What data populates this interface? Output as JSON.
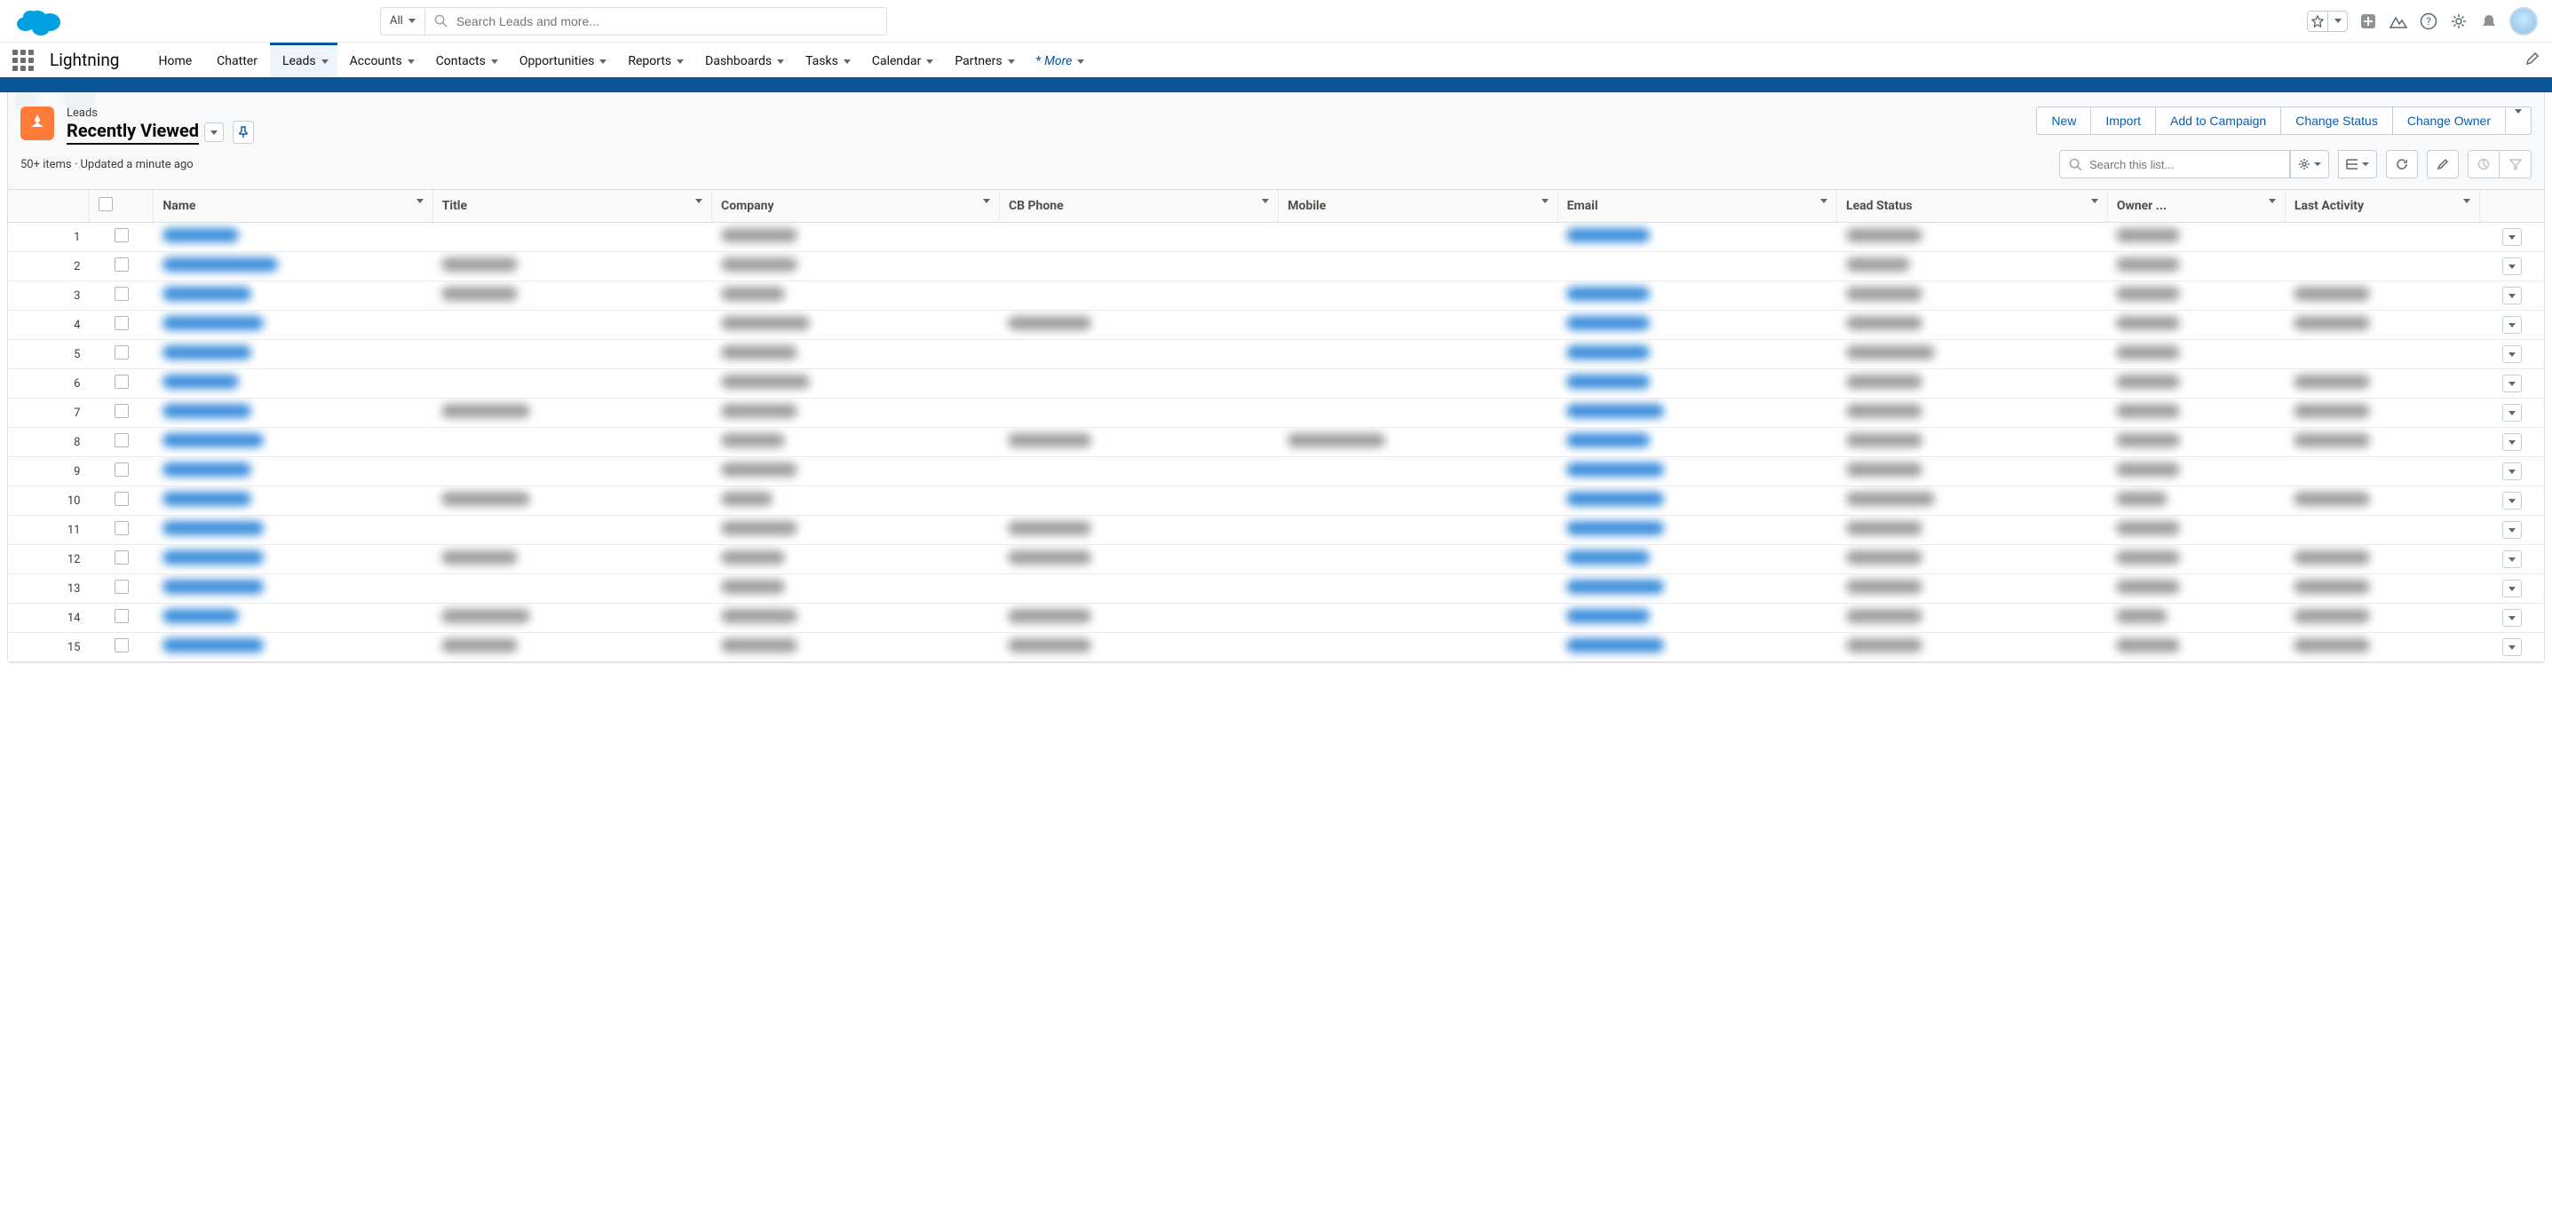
{
  "search": {
    "scope": "All",
    "placeholder": "Search Leads and more..."
  },
  "app_name": "Lightning",
  "nav": {
    "items": [
      "Home",
      "Chatter",
      "Leads",
      "Accounts",
      "Contacts",
      "Opportunities",
      "Reports",
      "Dashboards",
      "Tasks",
      "Calendar",
      "Partners"
    ],
    "more": "More",
    "active": "Leads"
  },
  "page": {
    "object_label": "Leads",
    "view_name": "Recently Viewed",
    "meta": "50+ items · Updated a minute ago"
  },
  "actions": {
    "new": "New",
    "import": "Import",
    "add_to_campaign": "Add to Campaign",
    "change_status": "Change Status",
    "change_owner": "Change Owner"
  },
  "list_toolbar": {
    "search_placeholder": "Search this list..."
  },
  "columns": {
    "name": "Name",
    "title": "Title",
    "company": "Company",
    "cb_phone": "CB Phone",
    "mobile": "Mobile",
    "email": "Email",
    "lead_status": "Lead Status",
    "owner": "Owner ...",
    "last_activity": "Last Activity"
  },
  "rows": [
    {
      "n": 1,
      "name": "████",
      "title": "",
      "company": "████",
      "cb_phone": "",
      "mobile": "",
      "email": "████",
      "status": "████",
      "owner": "███",
      "activity": ""
    },
    {
      "n": 2,
      "name": "████████",
      "title": "████",
      "company": "████",
      "cb_phone": "",
      "mobile": "",
      "email": "",
      "status": "███",
      "owner": "███",
      "activity": ""
    },
    {
      "n": 3,
      "name": "█████",
      "title": "████",
      "company": "███",
      "cb_phone": "",
      "mobile": "",
      "email": "████",
      "status": "████",
      "owner": "███",
      "activity": "████"
    },
    {
      "n": 4,
      "name": "██████",
      "title": "",
      "company": "█████",
      "cb_phone": "████",
      "mobile": "",
      "email": "████",
      "status": "████",
      "owner": "███",
      "activity": "████"
    },
    {
      "n": 5,
      "name": "█████",
      "title": "",
      "company": "████",
      "cb_phone": "",
      "mobile": "",
      "email": "████",
      "status": "█████",
      "owner": "███",
      "activity": ""
    },
    {
      "n": 6,
      "name": "████",
      "title": "",
      "company": "█████",
      "cb_phone": "",
      "mobile": "",
      "email": "████",
      "status": "████",
      "owner": "███",
      "activity": "████"
    },
    {
      "n": 7,
      "name": "█████",
      "title": "█████",
      "company": "████",
      "cb_phone": "",
      "mobile": "",
      "email": "█████",
      "status": "████",
      "owner": "███",
      "activity": "████"
    },
    {
      "n": 8,
      "name": "██████",
      "title": "",
      "company": "███",
      "cb_phone": "████",
      "mobile": "█████",
      "email": "████",
      "status": "████",
      "owner": "███",
      "activity": "████"
    },
    {
      "n": 9,
      "name": "█████",
      "title": "",
      "company": "████",
      "cb_phone": "",
      "mobile": "",
      "email": "█████",
      "status": "████",
      "owner": "███",
      "activity": ""
    },
    {
      "n": 10,
      "name": "█████",
      "title": "█████",
      "company": "██",
      "cb_phone": "",
      "mobile": "",
      "email": "█████",
      "status": "█████",
      "owner": "██",
      "activity": "████"
    },
    {
      "n": 11,
      "name": "██████",
      "title": "",
      "company": "████",
      "cb_phone": "████",
      "mobile": "",
      "email": "█████",
      "status": "████",
      "owner": "███",
      "activity": ""
    },
    {
      "n": 12,
      "name": "██████",
      "title": "████",
      "company": "███",
      "cb_phone": "████",
      "mobile": "",
      "email": "████",
      "status": "████",
      "owner": "███",
      "activity": "████"
    },
    {
      "n": 13,
      "name": "██████",
      "title": "",
      "company": "███",
      "cb_phone": "",
      "mobile": "",
      "email": "█████",
      "status": "████",
      "owner": "███",
      "activity": "████"
    },
    {
      "n": 14,
      "name": "████",
      "title": "█████",
      "company": "████",
      "cb_phone": "████",
      "mobile": "",
      "email": "████",
      "status": "████",
      "owner": "██",
      "activity": "████"
    },
    {
      "n": 15,
      "name": "██████",
      "title": "████",
      "company": "████",
      "cb_phone": "████",
      "mobile": "",
      "email": "█████",
      "status": "████",
      "owner": "███",
      "activity": "████"
    }
  ]
}
